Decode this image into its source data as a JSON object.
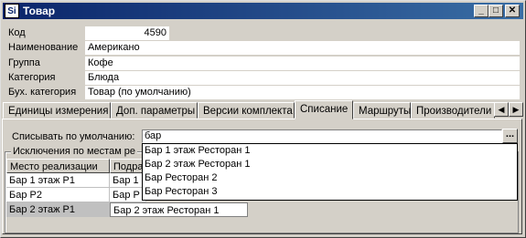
{
  "window": {
    "title": "Товар",
    "icon_label": "Si"
  },
  "fields": [
    {
      "label": "Код",
      "value": "4590"
    },
    {
      "label": "Наименование",
      "value": "Американо"
    },
    {
      "label": "Группа",
      "value": "Кофе"
    },
    {
      "label": "Категория",
      "value": "Блюда"
    },
    {
      "label": "Бух. категория",
      "value": "Товар (по умолчанию)"
    }
  ],
  "tabs": [
    "Единицы измерения",
    "Доп. параметры",
    "Версии комплекта",
    "Списание",
    "Маршруты",
    "Производители"
  ],
  "active_tab": "Списание",
  "writeoff": {
    "default_label": "Списывать по умолчанию:",
    "default_value": "бар",
    "ellipsis_label": "...",
    "group_title": "Исключения по местам  ре"
  },
  "table": {
    "headers": [
      "Место реализации",
      "Подра"
    ],
    "rows": [
      [
        "Бар 1 этаж Р1",
        "Бар 1"
      ],
      [
        "Бар Р2",
        "Бар Р"
      ],
      [
        "Бар 2 этаж Р1",
        "Бар 2 этаж Ресторан 1"
      ]
    ]
  },
  "dropdown_options": [
    "Бар 1 этаж Ресторан 1",
    "Бар 2 этаж Ресторан 1",
    "Бар Ресторан 2",
    "Бар Ресторан 3"
  ],
  "colors": {
    "titlebar": "#0a246a",
    "face": "#d4d0c8",
    "selected_row": "#c0c0c0"
  },
  "icons": [
    "minimize-icon",
    "maximize-icon",
    "close-icon",
    "tab-scroll-left-icon",
    "tab-scroll-right-icon"
  ]
}
